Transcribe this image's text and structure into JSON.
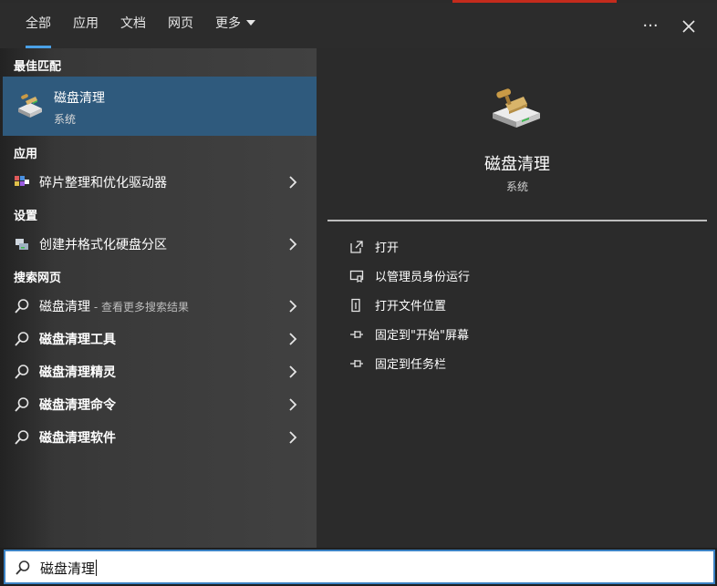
{
  "tabs": {
    "all": "全部",
    "apps": "应用",
    "docs": "文档",
    "web": "网页",
    "more": "更多"
  },
  "header": {
    "more_options": "···",
    "close": "✕"
  },
  "sections": {
    "best_match": "最佳匹配",
    "apps": "应用",
    "settings": "设置",
    "web_search": "搜索网页"
  },
  "best_match": {
    "title": "磁盘清理",
    "subtitle": "系统",
    "icon": "disk-cleanup-icon"
  },
  "app_results": [
    {
      "label": "碎片整理和优化驱动器",
      "icon": "defrag-icon"
    }
  ],
  "settings_results": [
    {
      "label": "创建并格式化硬盘分区",
      "icon": "disk-management-icon"
    }
  ],
  "web_results": [
    {
      "label": "磁盘清理",
      "hint": " - 查看更多搜索结果"
    },
    {
      "label": "磁盘清理工具"
    },
    {
      "label": "磁盘清理精灵"
    },
    {
      "label": "磁盘清理命令"
    },
    {
      "label": "磁盘清理软件"
    }
  ],
  "preview": {
    "title": "磁盘清理",
    "subtitle": "系统",
    "actions": [
      {
        "label": "打开",
        "icon": "open-icon"
      },
      {
        "label": "以管理员身份运行",
        "icon": "run-as-admin-icon"
      },
      {
        "label": "打开文件位置",
        "icon": "file-location-icon"
      },
      {
        "label": "固定到\"开始\"屏幕",
        "icon": "pin-icon"
      },
      {
        "label": "固定到任务栏",
        "icon": "pin-icon"
      }
    ]
  },
  "search": {
    "value": "磁盘清理"
  },
  "colors": {
    "accent": "#4aa0e6",
    "selected": "#2f5a7d",
    "searchBorder": "#3b82c4"
  }
}
